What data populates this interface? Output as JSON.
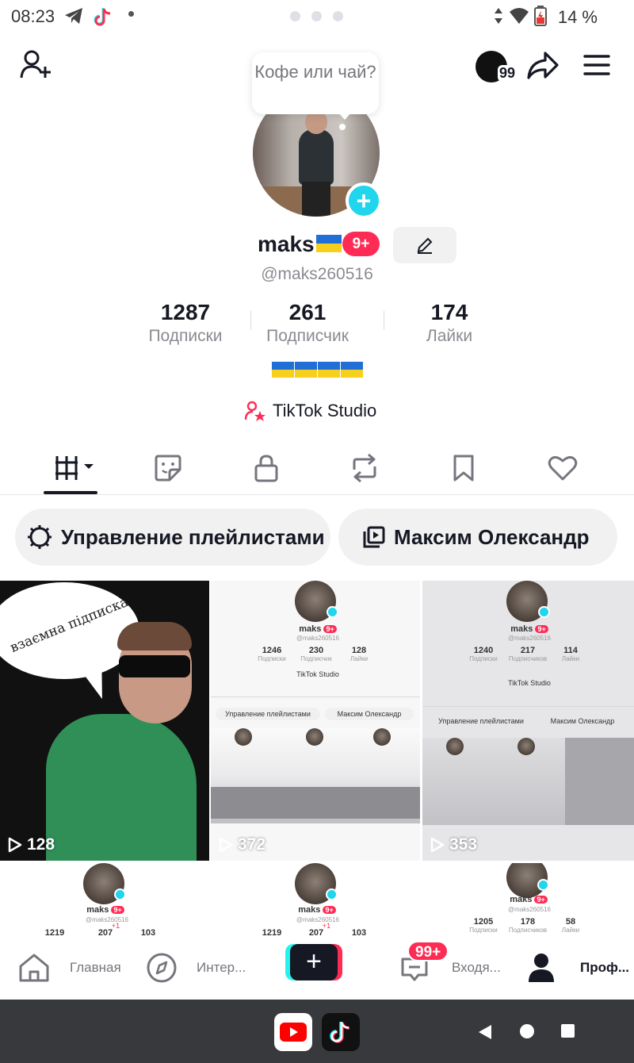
{
  "status_bar": {
    "time": "08:23",
    "battery_text": "14 %",
    "icons": [
      "telegram-icon",
      "tiktok-icon",
      "dot-icon",
      "data-arrows-icon",
      "wifi-icon",
      "battery-icon"
    ]
  },
  "header": {
    "notes_count": "99",
    "icons": [
      "add-user-icon",
      "mood-ball-icon",
      "share-icon",
      "menu-icon"
    ]
  },
  "profile": {
    "bubble_text": "Кофе или чай?",
    "name": "maks",
    "name_badge": "9+",
    "handle": "@maks260516",
    "stats": [
      {
        "value": "1287",
        "label": "Подписки"
      },
      {
        "value": "261",
        "label": "Подписчик"
      },
      {
        "value": "174",
        "label": "Лайки"
      }
    ],
    "bio_flags_count": 4,
    "studio_label": "TikTok Studio"
  },
  "tabs": [
    "videos-icon",
    "sticker-icon",
    "lock-icon",
    "repost-icon",
    "bookmark-icon",
    "heart-icon"
  ],
  "chips": {
    "playlists_label": "Управление плейлистами",
    "user_label": "Максим Олександр"
  },
  "videos": [
    {
      "views": "128",
      "caption": "взаємна підписка"
    },
    {
      "views": "372"
    },
    {
      "views": "353"
    }
  ],
  "mini_profiles": {
    "row1": [
      {
        "name": "maks",
        "badge": "9+",
        "handle": "@maks260516",
        "stats": [
          "1246",
          "230",
          "128"
        ],
        "labels": [
          "Подписки",
          "Подписчик",
          "Лайки"
        ],
        "studio": "TikTok Studio",
        "chip1": "Управление плейлистами",
        "chip2": "Максим Олександр"
      },
      {
        "name": "maks",
        "badge": "9+",
        "handle": "@maks260516",
        "stats": [
          "1240",
          "217",
          "114"
        ],
        "labels": [
          "Подписки",
          "Подписчиков",
          "Лайки"
        ],
        "studio": "TikTok Studio",
        "chip1": "Управление плейлистами",
        "chip2": "Максим Олександр"
      }
    ],
    "row2": [
      {
        "name": "maks",
        "badge": "9+",
        "handle": "@maks260516",
        "stats": [
          "1219",
          "207",
          "103"
        ],
        "plus": "+1"
      },
      {
        "name": "maks",
        "badge": "9+",
        "handle": "@maks260516",
        "stats": [
          "1219",
          "207",
          "103"
        ],
        "plus": "+1"
      },
      {
        "name": "maks",
        "badge": "9+",
        "handle": "@maks260516",
        "stats": [
          "1205",
          "178",
          "58"
        ],
        "labels": [
          "Подписки",
          "Подписчиков",
          "Лайки"
        ]
      }
    ]
  },
  "bottom_nav": {
    "home": "Главная",
    "explore": "Интер...",
    "inbox": "Входя...",
    "inbox_badge": "99+",
    "profile": "Проф..."
  },
  "colors": {
    "accent_red": "#fe2c55",
    "accent_cyan": "#25f4ee",
    "avatar_plus": "#20d5ec",
    "text": "#161823",
    "muted": "#8a8b91"
  }
}
